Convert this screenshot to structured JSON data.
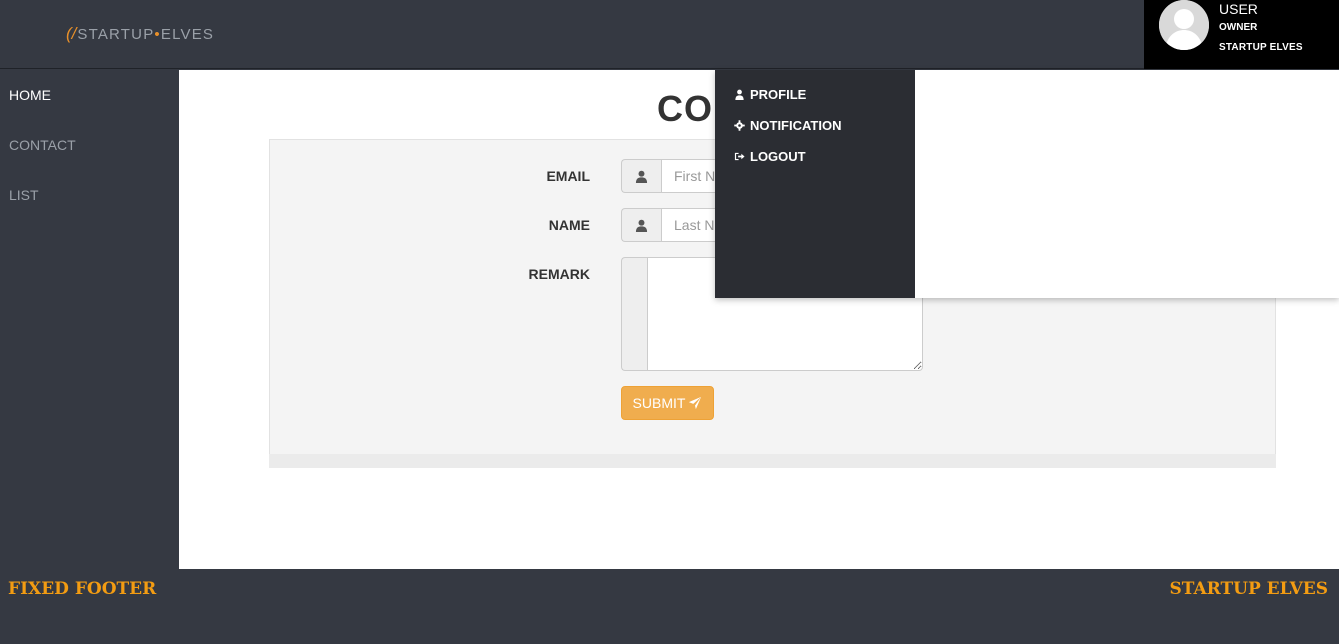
{
  "header": {
    "logo_mark": "(/",
    "logo_text_start": "STARTUP",
    "logo_dot": "•",
    "logo_text_end": "ELVES",
    "user": {
      "name": "USER",
      "role": "OWNER",
      "company": "STARTUP ELVES"
    }
  },
  "sidebar": {
    "items": [
      {
        "label": "HOME",
        "active": true
      },
      {
        "label": "CONTACT",
        "active": false
      },
      {
        "label": "LIST",
        "active": false
      }
    ]
  },
  "main": {
    "title": "CONTACT",
    "form": {
      "email_label": "EMAIL",
      "email_placeholder": "First Name",
      "email_icon": "user-icon",
      "name_label": "NAME",
      "name_placeholder": "Last Name",
      "name_icon": "user-icon",
      "remark_label": "REMARK",
      "submit_label": "SUBMIT",
      "submit_icon": "send-icon"
    }
  },
  "dropdown": {
    "items": [
      {
        "label": "PROFILE",
        "icon": "user-icon"
      },
      {
        "label": "NOTIFICATION",
        "icon": "gear-icon"
      },
      {
        "label": "LOGOUT",
        "icon": "logout-icon"
      }
    ]
  },
  "footer": {
    "left": "FIXED FOOTER",
    "right": "STARTUP ELVES"
  },
  "colors": {
    "background": "#353942",
    "accent": "#f39c12",
    "button": "#f0ad4e",
    "dropdown_menu": "#2b2d33"
  }
}
